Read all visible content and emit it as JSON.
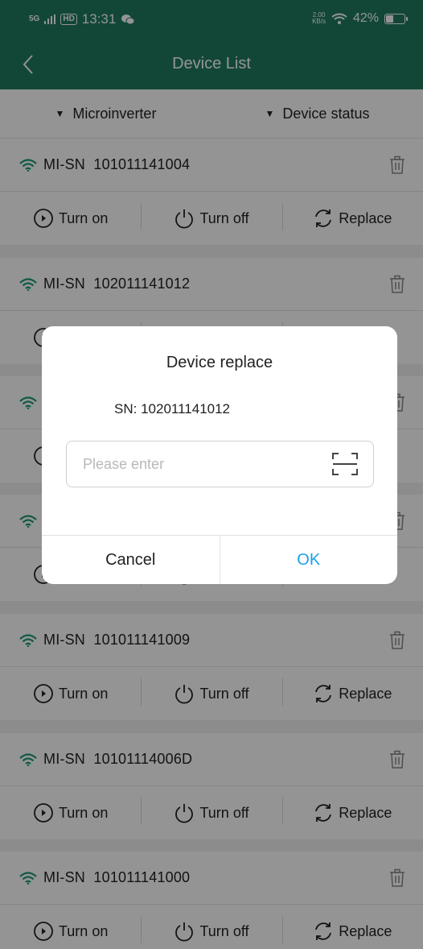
{
  "status_bar": {
    "network": "5G",
    "hd": "HD",
    "time": "13:31",
    "speed_top": "2.00",
    "speed_unit": "KB/s",
    "battery": "42%",
    "battery_level": 0.42
  },
  "header": {
    "title": "Device List",
    "back_icon": "chevron-left-icon"
  },
  "filters": [
    {
      "label": "Microinverter",
      "icon": "triangle-down-icon"
    },
    {
      "label": "Device status",
      "icon": "triangle-down-icon"
    }
  ],
  "actions": {
    "turn_on": "Turn on",
    "turn_off": "Turn off",
    "replace": "Replace"
  },
  "devices": [
    {
      "prefix": "MI-SN",
      "sn": "101011141004"
    },
    {
      "prefix": "MI-SN",
      "sn": "102011141012"
    },
    {
      "prefix": "MI-SN",
      "sn": ""
    },
    {
      "prefix": "MI-SN",
      "sn": ""
    },
    {
      "prefix": "MI-SN",
      "sn": "101011141009"
    },
    {
      "prefix": "MI-SN",
      "sn": "10101114006D"
    },
    {
      "prefix": "MI-SN",
      "sn": "101011141000"
    }
  ],
  "dialog": {
    "title": "Device replace",
    "sn_label": "SN:",
    "sn_value": "102011141012",
    "input_placeholder": "Please enter",
    "cancel": "Cancel",
    "ok": "OK"
  },
  "colors": {
    "header_bg": "#1f7a61",
    "wifi_icon": "#1a9a78",
    "ok_button": "#1aa0e6"
  }
}
